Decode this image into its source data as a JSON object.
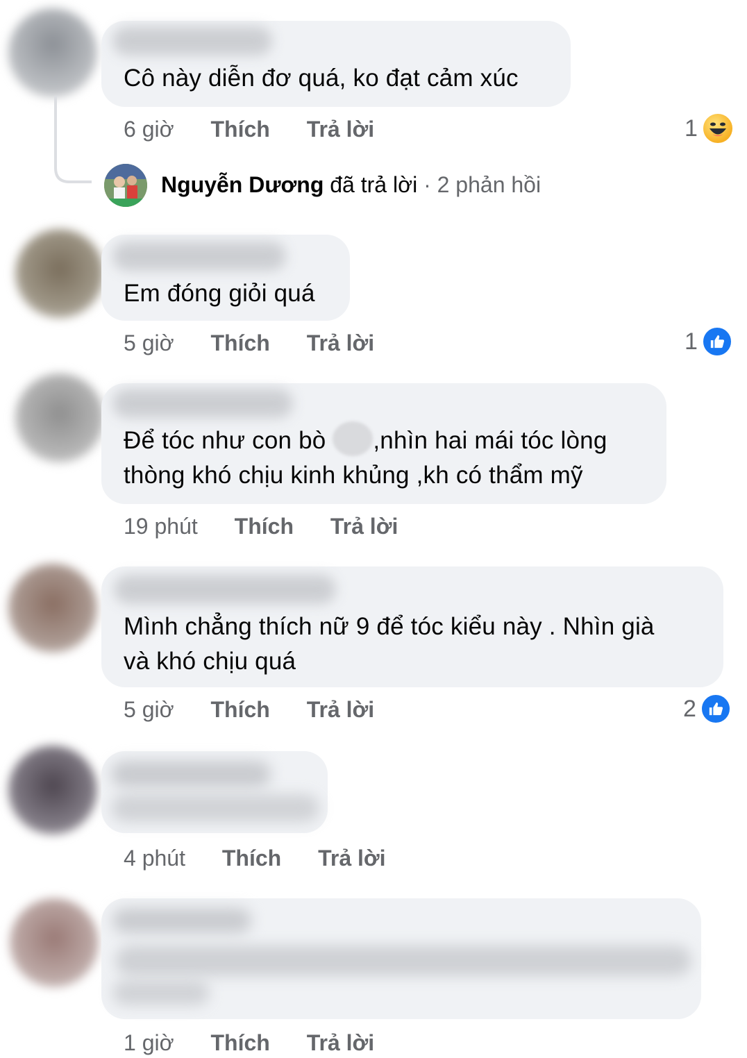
{
  "comments": [
    {
      "text_lines": [
        "Cô này diễn đơ quá, ko đạt cảm xúc"
      ],
      "time": "6 giờ",
      "like_label": "Thích",
      "reply_label": "Trả lời",
      "reaction": {
        "count": "1",
        "icon": "haha-icon"
      }
    },
    {
      "text_lines": [
        "Em đóng giỏi quá"
      ],
      "time": "5 giờ",
      "like_label": "Thích",
      "reply_label": "Trả lời",
      "reaction": {
        "count": "1",
        "icon": "like-icon"
      }
    },
    {
      "text_lines": [
        "Để tóc như con bò ",
        ",nhìn hai mái tóc lòng",
        "thòng khó chịu kinh khủng ,kh có thẩm mỹ"
      ],
      "time": "19 phút",
      "like_label": "Thích",
      "reply_label": "Trả lời"
    },
    {
      "text_lines": [
        "Mình chẳng thích nữ 9 để tóc kiểu này . Nhìn  già",
        "và khó chịu quá"
      ],
      "time": "5 giờ",
      "like_label": "Thích",
      "reply_label": "Trả lời",
      "reaction": {
        "count": "2",
        "icon": "like-icon"
      }
    },
    {
      "text_lines": [],
      "time": "4 phút",
      "like_label": "Thích",
      "reply_label": "Trả lời"
    },
    {
      "text_lines": [],
      "time": "1 giờ",
      "like_label": "Thích",
      "reply_label": "Trả lời"
    }
  ],
  "reply_summary": {
    "name": "Nguyễn Dương",
    "action": "đã trả lời",
    "separator": "·",
    "count": "2 phản hồi"
  },
  "colors": {
    "bubble": "#f0f2f5",
    "meta_text": "#65676b",
    "like_blue": "#1877f2"
  }
}
